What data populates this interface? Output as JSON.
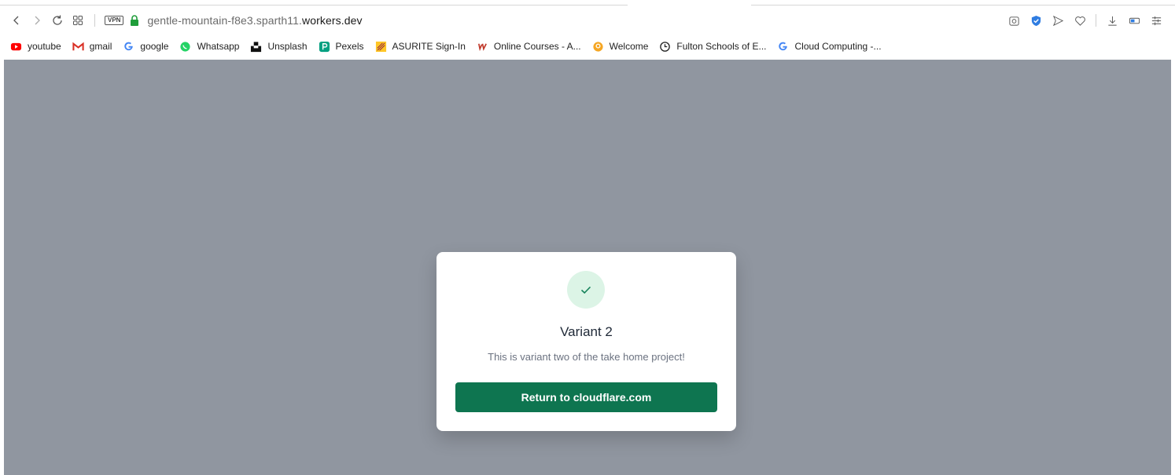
{
  "browser": {
    "url_path": "gentle-mountain-f8e3.sparth11.",
    "url_host": "workers.dev",
    "vpn_label": "VPN",
    "nav_icons": [
      "back-icon",
      "forward-icon",
      "reload-icon",
      "tabs-grid-icon"
    ],
    "toolbar_icons": [
      "camera-icon",
      "shield-icon",
      "send-icon",
      "heart-icon",
      "download-icon",
      "battery-icon",
      "settings-sliders-icon"
    ]
  },
  "bookmarks": [
    {
      "label": "youtube",
      "icon": "youtube-icon",
      "color": "#ff0000"
    },
    {
      "label": "gmail",
      "icon": "gmail-icon",
      "color": "#d93025"
    },
    {
      "label": "google",
      "icon": "google-icon",
      "color": "#4285f4"
    },
    {
      "label": "Whatsapp",
      "icon": "whatsapp-icon",
      "color": "#25d366"
    },
    {
      "label": "Unsplash",
      "icon": "unsplash-icon",
      "color": "#111111"
    },
    {
      "label": "Pexels",
      "icon": "pexels-icon",
      "color": "#05a081"
    },
    {
      "label": "ASURITE Sign-In",
      "icon": "asu-icon",
      "color": "#ffc627"
    },
    {
      "label": "Online Courses - A...",
      "icon": "udemy-icon",
      "color": "#c0392b"
    },
    {
      "label": "Welcome",
      "icon": "welcome-icon",
      "color": "#f5a623"
    },
    {
      "label": "Fulton Schools of E...",
      "icon": "clock-icon",
      "color": "#222222"
    },
    {
      "label": "Cloud Computing -...",
      "icon": "google-icon",
      "color": "#4285f4"
    }
  ],
  "card": {
    "title": "Variant 2",
    "text": "This is variant two of the take home project!",
    "button_label": "Return to cloudflare.com",
    "accent": "#0e7550",
    "check_bg": "#dcf4e6"
  },
  "colors": {
    "page_background": "#9096a0"
  }
}
